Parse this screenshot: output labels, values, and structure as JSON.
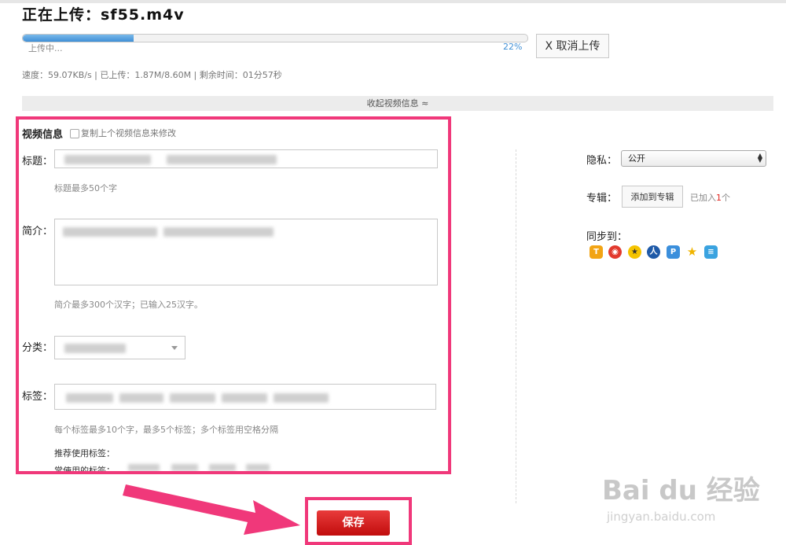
{
  "upload": {
    "title": "正在上传：sf55.m4v",
    "status": "上传中...",
    "percent": "22%",
    "progress_fraction": 0.22,
    "cancel_label": "X 取消上传",
    "stats": "速度：59.07KB/s | 已上传：1.87M/8.60M | 剩余时间：01分57秒",
    "collapse_label": "收起视频信息 ≈"
  },
  "form": {
    "section_title": "视频信息",
    "copy_label": "复制上个视频信息来修改",
    "title_label": "标题：",
    "title_hint": "标题最多50个字",
    "intro_label": "简介：",
    "intro_hint": "简介最多300个汉字；已输入25汉字。",
    "category_label": "分类：",
    "tags_label": "标签：",
    "tags_hint": "每个标签最多10个字，最多5个标签；多个标签用空格分隔",
    "recommended_label": "推荐使用标签：",
    "common_label": "常使用的标签："
  },
  "side": {
    "privacy_label": "隐私：",
    "privacy_value": "公开",
    "album_label": "专辑：",
    "album_button": "添加到专辑",
    "album_added_prefix": "已加入",
    "album_added_count": "1",
    "album_added_suffix": "个",
    "sync_label": "同步到：",
    "sync_icons": [
      "tencent-weibo-icon",
      "sina-weibo-icon",
      "qzone-icon",
      "renren-icon",
      "pengyou-icon",
      "star-icon",
      "kaixin-icon"
    ]
  },
  "save_label": "保存",
  "watermark": {
    "text": "Bai du 经验",
    "url": "jingyan.baidu.com"
  },
  "colors": {
    "highlight": "#f0387a",
    "save": "#d31f1f",
    "progress": "#4a97dc"
  }
}
